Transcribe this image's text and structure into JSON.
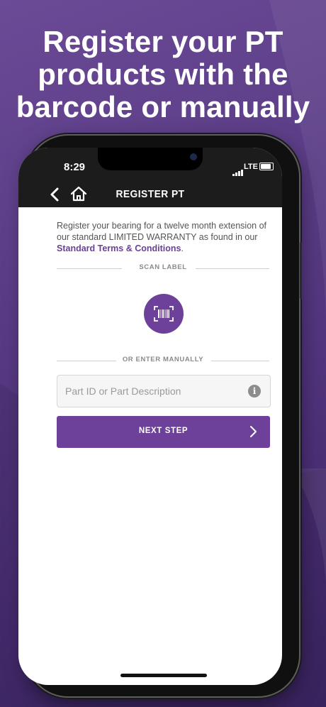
{
  "headline": "Register your PT\nproducts with the\nbarcode or manually",
  "status_bar": {
    "time": "8:29",
    "network": "LTE"
  },
  "nav": {
    "title": "REGISTER PT"
  },
  "intro": {
    "text": "Register your bearing for a twelve month extension of our standard LIMITED WARRANTY as found in our ",
    "link": "Standard Terms & Conditions",
    "suffix": "."
  },
  "scan_section": {
    "label": "SCAN LABEL"
  },
  "manual_section": {
    "label": "OR ENTER MANUALLY"
  },
  "part_input": {
    "placeholder": "Part ID or Part Description",
    "value": ""
  },
  "next_button": {
    "label": "NEXT STEP"
  },
  "colors": {
    "accent": "#6d4199",
    "nav_bg": "#1c1c1c",
    "link": "#6a3f9b"
  },
  "icons": [
    "chevron-left-icon",
    "home-icon",
    "barcode-icon",
    "info-icon",
    "chevron-right-icon"
  ]
}
